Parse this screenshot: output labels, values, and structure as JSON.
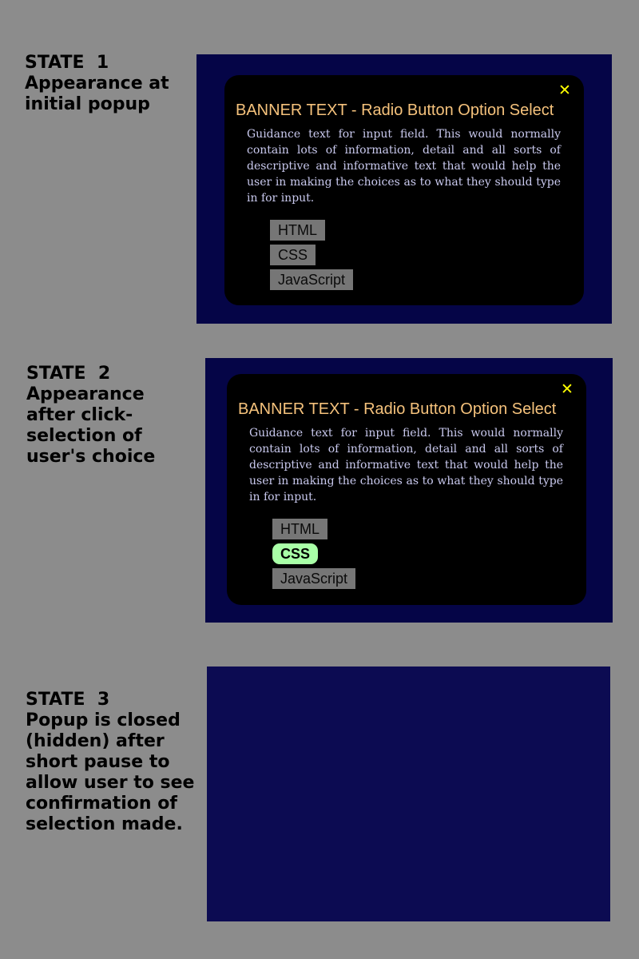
{
  "states": [
    {
      "heading": "STATE  1",
      "description": "Appearance at initial popup",
      "popup": {
        "close_glyph": "✕",
        "banner": "BANNER TEXT - Radio Button Option Select",
        "guidance": "Guidance text for input field. This would normally contain lots of information, detail and all sorts of descriptive and informative text that would help the user in making the choices as to what they should type in for input.",
        "options": [
          "HTML",
          "CSS",
          "JavaScript"
        ],
        "selected": null
      }
    },
    {
      "heading": "STATE  2",
      "description": "Appearance after click-selection of user's choice",
      "popup": {
        "close_glyph": "✕",
        "banner": "BANNER TEXT - Radio Button Option Select",
        "guidance": "Guidance text for input field. This would normally contain lots of information, detail and all sorts of descriptive and informative text that would help the user in making the choices as to what they should type in for input.",
        "options": [
          "HTML",
          "CSS",
          "JavaScript"
        ],
        "selected": "CSS"
      }
    },
    {
      "heading": "STATE  3",
      "description": "Popup is closed (hidden) after short pause to allow user to see confirmation of selection made.",
      "popup": null
    }
  ],
  "colors": {
    "page_background": "#8c8c8c",
    "screen_background": "#050547",
    "screen_background_hidden": "#0c0b52",
    "popup_background": "#000000",
    "banner_text": "#f5c27c",
    "guidance_text": "#c9c9ee",
    "close_icon": "#ffff00",
    "option_background": "#767676",
    "option_selected_background": "#a9ffa7"
  },
  "icons": {
    "close": "close-icon"
  }
}
